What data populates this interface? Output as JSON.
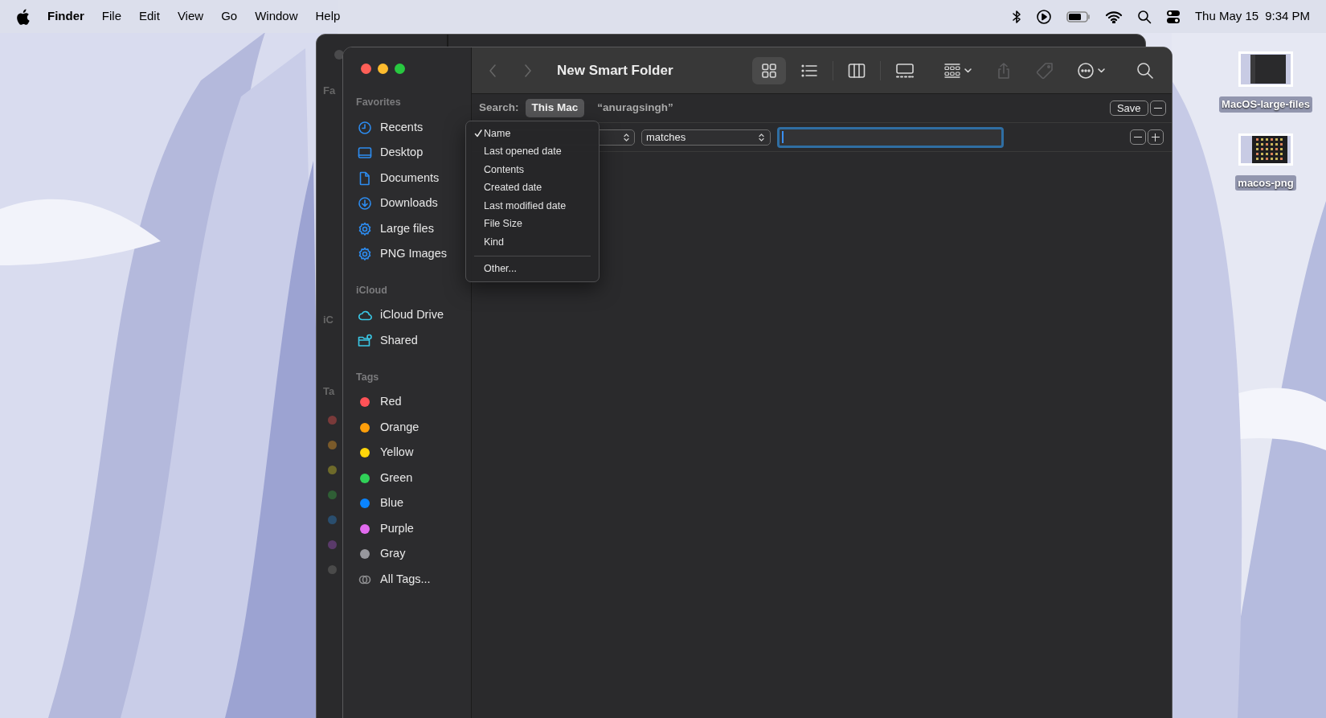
{
  "menu_bar": {
    "app": "Finder",
    "menus": [
      "File",
      "Edit",
      "View",
      "Go",
      "Window",
      "Help"
    ],
    "date": "Thu May 15",
    "time": "9:34 PM"
  },
  "back_window": {
    "labels": [
      "Fa",
      "iC",
      "Ta"
    ]
  },
  "window": {
    "title": "New Smart Folder",
    "toolbar": [
      {
        "kind": "icon-grid",
        "selected": true
      },
      {
        "kind": "list",
        "selected": false
      },
      {
        "kind": "divider"
      },
      {
        "kind": "columns",
        "selected": false
      },
      {
        "kind": "divider"
      },
      {
        "kind": "gallery",
        "selected": false
      },
      {
        "kind": "spacer"
      },
      {
        "kind": "group",
        "selected": false
      },
      {
        "kind": "share",
        "disabled": true
      },
      {
        "kind": "tag",
        "disabled": true
      },
      {
        "kind": "more",
        "selected": false
      },
      {
        "kind": "spacer"
      },
      {
        "kind": "search",
        "selected": false
      }
    ],
    "search_bar": {
      "label": "Search:",
      "scopes": [
        {
          "label": "This Mac",
          "selected": true
        },
        {
          "label": "“anuragsingh”",
          "selected": false
        }
      ],
      "save": "Save"
    },
    "criteria": {
      "operator": "matches"
    },
    "attribute_menu": [
      {
        "label": "Name",
        "selected": true,
        "separator_before": false
      },
      {
        "label": "Last opened date",
        "selected": false,
        "separator_before": false
      },
      {
        "label": "Contents",
        "selected": false,
        "separator_before": false
      },
      {
        "label": "Created date",
        "selected": false,
        "separator_before": false
      },
      {
        "label": "Last modified date",
        "selected": false,
        "separator_before": false
      },
      {
        "label": "File Size",
        "selected": false,
        "separator_before": false
      },
      {
        "label": "Kind",
        "selected": false,
        "separator_before": false
      },
      {
        "label": "Other...",
        "selected": false,
        "separator_before": true
      }
    ]
  },
  "sidebar": {
    "sections": [
      {
        "header": "Favorites",
        "items": [
          {
            "label": "Recents"
          },
          {
            "label": "Desktop"
          },
          {
            "label": "Documents"
          },
          {
            "label": "Downloads"
          },
          {
            "label": "Large files"
          },
          {
            "label": "PNG Images"
          }
        ]
      },
      {
        "header": "iCloud",
        "items": [
          {
            "label": "iCloud Drive"
          },
          {
            "label": "Shared"
          }
        ]
      },
      {
        "header": "Tags",
        "items": [
          {
            "label": "Red",
            "color": "#ff5257"
          },
          {
            "label": "Orange",
            "color": "#ff9f0a"
          },
          {
            "label": "Yellow",
            "color": "#ffd60a"
          },
          {
            "label": "Green",
            "color": "#30d158"
          },
          {
            "label": "Blue",
            "color": "#0a84ff"
          },
          {
            "label": "Purple",
            "color": "#e26bef"
          },
          {
            "label": "Gray",
            "color": "#98989d"
          },
          {
            "label": "All Tags..."
          }
        ]
      }
    ]
  },
  "desktop_icons": [
    {
      "label": "MacOS-large-files"
    },
    {
      "label": "macos-png"
    }
  ]
}
